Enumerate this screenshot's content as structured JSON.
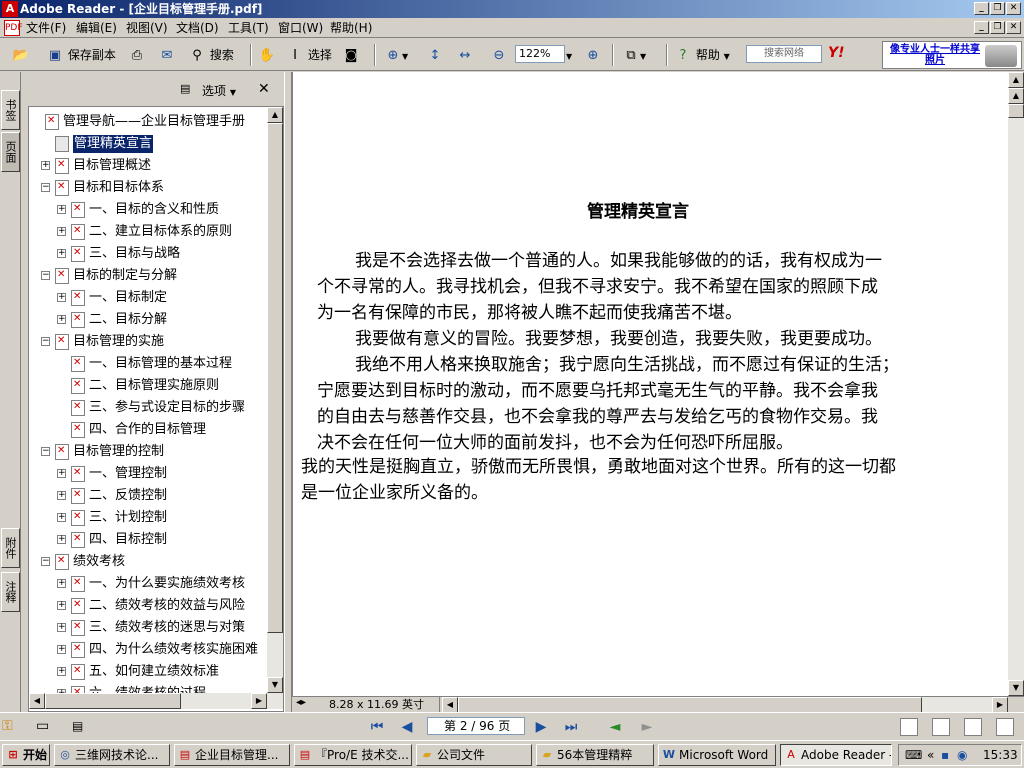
{
  "window": {
    "title": "Adobe Reader - [企业目标管理手册.pdf]"
  },
  "menu": {
    "items": [
      "文件(F)",
      "编辑(E)",
      "视图(V)",
      "文档(D)",
      "工具(T)",
      "窗口(W)",
      "帮助(H)"
    ]
  },
  "toolbar": {
    "save_copy": "保存副本",
    "search": "搜索",
    "select": "选择",
    "zoom": "122%",
    "help": "帮助",
    "search_web_placeholder": "搜索网络",
    "yahoo": "Y!",
    "ad_text": "像专业人士一样共享照片"
  },
  "left_tabs": {
    "bookmarks": "书签",
    "pages": "页面",
    "attachments": "附件",
    "comments": "注释"
  },
  "nav_panel": {
    "options_label": "选项",
    "close": "✕",
    "tree": [
      {
        "label": "管理导航——企业目标管理手册",
        "level": 0,
        "expander": "",
        "icon": "pdf",
        "selected": false
      },
      {
        "label": "管理精英宣言",
        "level": 1,
        "expander": "",
        "icon": "page",
        "selected": true
      },
      {
        "label": "目标管理概述",
        "level": 1,
        "expander": "+",
        "icon": "pdf",
        "selected": false
      },
      {
        "label": "目标和目标体系",
        "level": 1,
        "expander": "-",
        "icon": "pdf",
        "selected": false
      },
      {
        "label": "一、目标的含义和性质",
        "level": 2,
        "expander": "+",
        "icon": "pdf",
        "selected": false
      },
      {
        "label": "二、建立目标体系的原则",
        "level": 2,
        "expander": "+",
        "icon": "pdf",
        "selected": false
      },
      {
        "label": "三、目标与战略",
        "level": 2,
        "expander": "+",
        "icon": "pdf",
        "selected": false
      },
      {
        "label": "目标的制定与分解",
        "level": 1,
        "expander": "-",
        "icon": "pdf",
        "selected": false
      },
      {
        "label": "一、目标制定",
        "level": 2,
        "expander": "+",
        "icon": "pdf",
        "selected": false
      },
      {
        "label": "二、目标分解",
        "level": 2,
        "expander": "+",
        "icon": "pdf",
        "selected": false
      },
      {
        "label": "目标管理的实施",
        "level": 1,
        "expander": "-",
        "icon": "pdf",
        "selected": false
      },
      {
        "label": "一、目标管理的基本过程",
        "level": 2,
        "expander": "",
        "icon": "pdf",
        "selected": false
      },
      {
        "label": "二、目标管理实施原则",
        "level": 2,
        "expander": "",
        "icon": "pdf",
        "selected": false
      },
      {
        "label": "三、参与式设定目标的步骤",
        "level": 2,
        "expander": "",
        "icon": "pdf",
        "selected": false
      },
      {
        "label": "四、合作的目标管理",
        "level": 2,
        "expander": "",
        "icon": "pdf",
        "selected": false
      },
      {
        "label": "目标管理的控制",
        "level": 1,
        "expander": "-",
        "icon": "pdf",
        "selected": false
      },
      {
        "label": "一、管理控制",
        "level": 2,
        "expander": "+",
        "icon": "pdf",
        "selected": false
      },
      {
        "label": "二、反馈控制",
        "level": 2,
        "expander": "+",
        "icon": "pdf",
        "selected": false
      },
      {
        "label": "三、计划控制",
        "level": 2,
        "expander": "+",
        "icon": "pdf",
        "selected": false
      },
      {
        "label": "四、目标控制",
        "level": 2,
        "expander": "+",
        "icon": "pdf",
        "selected": false
      },
      {
        "label": "绩效考核",
        "level": 1,
        "expander": "-",
        "icon": "pdf",
        "selected": false
      },
      {
        "label": "一、为什么要实施绩效考核",
        "level": 2,
        "expander": "+",
        "icon": "pdf",
        "selected": false
      },
      {
        "label": "二、绩效考核的效益与风险",
        "level": 2,
        "expander": "+",
        "icon": "pdf",
        "selected": false
      },
      {
        "label": "三、绩效考核的迷思与对策",
        "level": 2,
        "expander": "+",
        "icon": "pdf",
        "selected": false
      },
      {
        "label": "四、为什么绩效考核实施困难",
        "level": 2,
        "expander": "+",
        "icon": "pdf",
        "selected": false
      },
      {
        "label": "五、如何建立绩效标准",
        "level": 2,
        "expander": "+",
        "icon": "pdf",
        "selected": false
      },
      {
        "label": "六、绩效考核的过程",
        "level": 2,
        "expander": "+",
        "icon": "pdf",
        "selected": false
      }
    ]
  },
  "document": {
    "title": "管理精英宣言",
    "lines": [
      "我是不会选择去做一个普通的人。如果我能够做的的话，我有权成为一",
      "个不寻常的人。我寻找机会，但我不寻求安宁。我不希望在国家的照顾下成",
      "为一名有保障的市民，那将被人瞧不起而使我痛苦不堪。",
      "我要做有意义的冒险。我要梦想，我要创造，我要失败，我更要成功。",
      "我绝不用人格来换取施舍；我宁愿向生活挑战，而不愿过有保证的生活；",
      "宁愿要达到目标时的激动，而不愿要乌托邦式毫无生气的平静。我不会拿我",
      "的自由去与慈善作交县，也不会拿我的尊严去与发给乞丐的食物作交易。我",
      "决不会在任何一位大师的面前发抖，也不会为任何恐吓所屈服。",
      "我的天性是挺胸直立，骄傲而无所畏惧，勇敢地面对这个世界。所有的这一切都",
      "是一位企业家所义备的。"
    ],
    "page_size": "8.28 x 11.69 英寸"
  },
  "bottom_nav": {
    "page_display": "第 2 / 96 页"
  },
  "taskbar": {
    "start": "开始",
    "tasks": [
      {
        "label": "三维网技术论...",
        "active": false
      },
      {
        "label": "企业目标管理...",
        "active": false
      },
      {
        "label": "『Pro/E 技术交...",
        "active": false
      },
      {
        "label": "公司文件",
        "active": false
      },
      {
        "label": "56本管理精粹",
        "active": false
      },
      {
        "label": "Microsoft Word",
        "active": false
      },
      {
        "label": "Adobe Reader -...",
        "active": true
      }
    ],
    "clock": "15:33"
  }
}
